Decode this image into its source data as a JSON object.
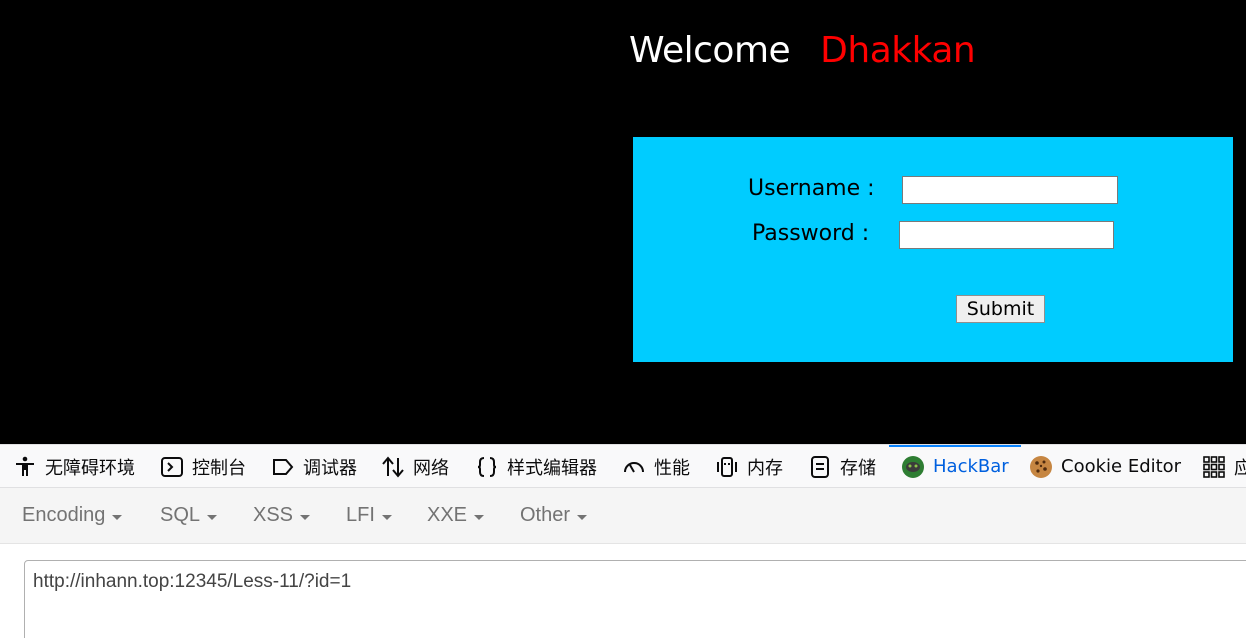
{
  "webpage": {
    "welcome_text": "Welcome",
    "welcome_name": "Dhakkan",
    "form": {
      "username_label": "Username :",
      "password_label": "Password :",
      "username_value": "",
      "password_value": "",
      "submit_label": "Submit"
    },
    "colors": {
      "background": "#000000",
      "welcome": "#ffffff",
      "name": "#ff0000",
      "form_box": "#00ccff"
    }
  },
  "devtools": {
    "tabs": [
      {
        "label": "无障碍环境",
        "icon": "accessibility-icon"
      },
      {
        "label": "控制台",
        "icon": "console-icon"
      },
      {
        "label": "调试器",
        "icon": "debugger-icon"
      },
      {
        "label": "网络",
        "icon": "network-icon"
      },
      {
        "label": "样式编辑器",
        "icon": "style-editor-icon"
      },
      {
        "label": "性能",
        "icon": "performance-icon"
      },
      {
        "label": "内存",
        "icon": "memory-icon"
      },
      {
        "label": "存储",
        "icon": "storage-icon"
      },
      {
        "label": "HackBar",
        "icon": "hackbar-icon",
        "active": true
      },
      {
        "label": "Cookie Editor",
        "icon": "cookie-icon"
      },
      {
        "label": "应",
        "icon": "application-icon"
      }
    ],
    "hackbar": {
      "menus": [
        "Encoding",
        "SQL",
        "XSS",
        "LFI",
        "XXE",
        "Other"
      ],
      "url": "http://inhann.top:12345/Less-11/?id=1"
    },
    "accent_color": "#0a84ff"
  }
}
